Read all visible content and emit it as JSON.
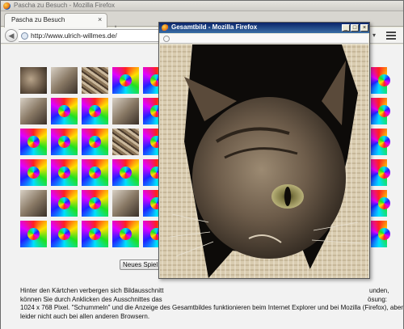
{
  "window": {
    "title": "Pascha zu Besuch - Mozilla Firefox"
  },
  "tabs": [
    {
      "label": "Pascha zu Besuch",
      "active": true
    }
  ],
  "toolbar": {
    "url": "http://www.ulrich-willmes.de/",
    "new_tab_symbol": "+",
    "tab_close_symbol": "×",
    "back_symbol": "◀",
    "dropdown_symbol": "▾"
  },
  "game": {
    "new_game_button": "Neues Spiel",
    "tiles_visible": [
      [
        "cat",
        "cat",
        "cat",
        "swirl",
        "swirl"
      ],
      [
        "cat",
        "swirl",
        "swirl",
        "cat",
        "swirl"
      ],
      [
        "swirl",
        "swirl",
        "swirl",
        "cat",
        "swirl"
      ],
      [
        "swirl",
        "swirl",
        "swirl",
        "swirl",
        "swirl"
      ],
      [
        "cat",
        "swirl",
        "swirl",
        "cat",
        "swirl"
      ],
      [
        "swirl",
        "swirl",
        "swirl",
        "swirl",
        "swirl"
      ]
    ],
    "right_column_visible": [
      "swirl",
      "swirl",
      "swirl",
      "swirl",
      "swirl",
      "swirl"
    ]
  },
  "description": {
    "line1_left": "Hinter den Kärtchen verbergen sich Bildausschnitt",
    "line1_right": "unden,",
    "line2_left": "können Sie durch Anklicken des Ausschnittes das",
    "line2_right": "ösung:",
    "line3": "1024 x 768 Pixel. \"Schummeln\" und die Anzeige des Gesamtbildes funktionieren beim Internet Explorer und bei Mozilla (Firefox), aber",
    "line4": "leider nicht auch bei allen anderen Browsern."
  },
  "popup": {
    "title": "Gesamtbild - Mozilla Firefox",
    "minimize_symbol": "_",
    "maximize_symbol": "□",
    "close_symbol": "×"
  },
  "colors": {
    "popup_title_start": "#0a246a",
    "popup_title_end": "#3a6ea5",
    "page_background": "#f2f2f2"
  }
}
